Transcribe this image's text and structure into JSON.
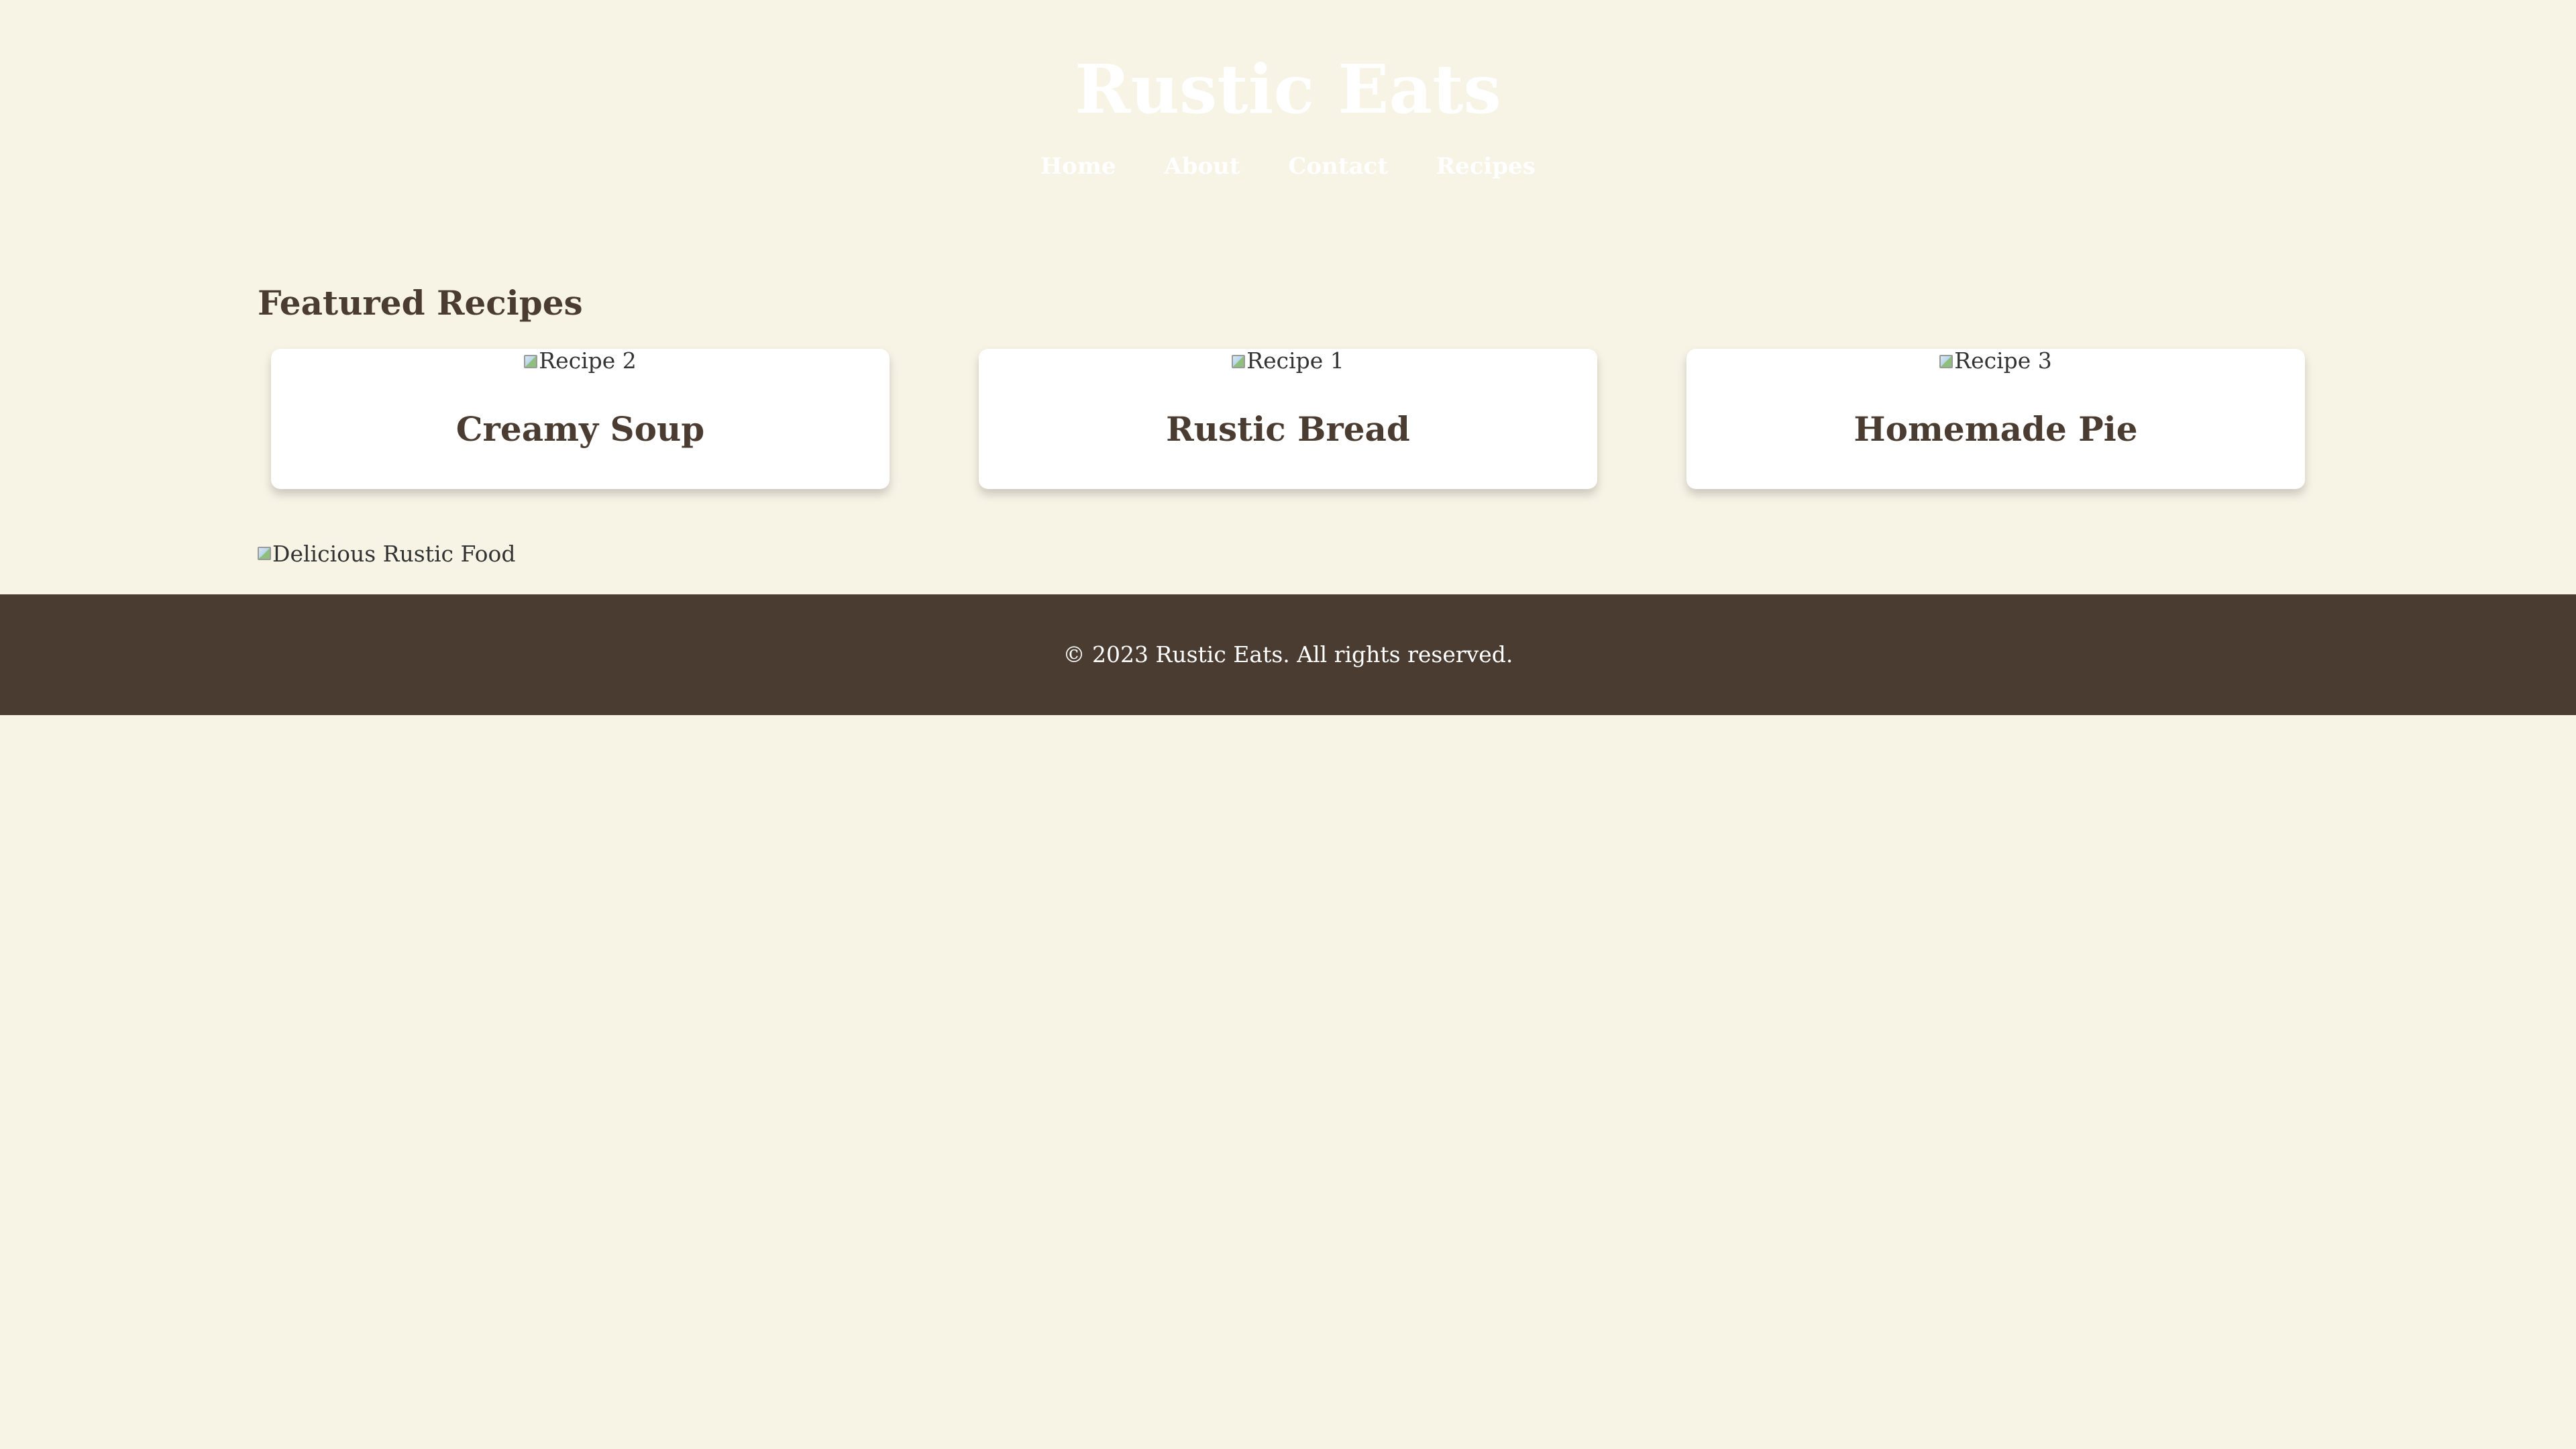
{
  "header": {
    "site_title": "Rustic Eats",
    "nav": [
      {
        "label": "Home"
      },
      {
        "label": "About"
      },
      {
        "label": "Contact"
      },
      {
        "label": "Recipes"
      }
    ]
  },
  "featured": {
    "title": "Featured Recipes",
    "cards": [
      {
        "image_alt": "Recipe 2",
        "title": "Creamy Soup"
      },
      {
        "image_alt": "Recipe 1",
        "title": "Rustic Bread"
      },
      {
        "image_alt": "Recipe 3",
        "title": "Homemade Pie"
      }
    ]
  },
  "hero_image": {
    "alt": "Delicious Rustic Food"
  },
  "footer": {
    "text": "© 2023 Rustic Eats. All rights reserved."
  },
  "colors": {
    "background": "#f7f3e5",
    "text_brown": "#4a3c31",
    "footer_bg": "#4a3c31",
    "card_bg": "#ffffff"
  }
}
